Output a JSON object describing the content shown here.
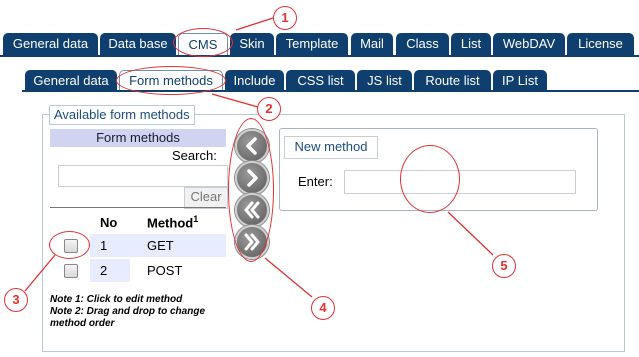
{
  "top_tabs": [
    {
      "label": "General data"
    },
    {
      "label": "Data base"
    },
    {
      "label": "CMS"
    },
    {
      "label": "Skin"
    },
    {
      "label": "Template"
    },
    {
      "label": "Mail"
    },
    {
      "label": "Class"
    },
    {
      "label": "List"
    },
    {
      "label": "WebDAV"
    },
    {
      "label": "License"
    }
  ],
  "sub_tabs": [
    {
      "label": "General data"
    },
    {
      "label": "Form methods"
    },
    {
      "label": "Include"
    },
    {
      "label": "CSS list"
    },
    {
      "label": "JS list"
    },
    {
      "label": "Route list"
    },
    {
      "label": "IP List"
    }
  ],
  "panel": {
    "legend": "Available form methods",
    "header": "Form methods",
    "search_label": "Search:",
    "search_value": "",
    "clear_label": "Clear",
    "col_no": "No",
    "col_method": "Method",
    "col_method_sup": "1",
    "rows": [
      {
        "no": "1",
        "method": "GET"
      },
      {
        "no": "2",
        "method": "POST"
      }
    ],
    "note1": "Note 1: Click to edit method",
    "note2": "Note 2: Drag and drop to change method order"
  },
  "nav_buttons": [
    {
      "icon": "chevron-left-icon"
    },
    {
      "icon": "chevron-right-icon"
    },
    {
      "icon": "double-chevron-left-icon"
    },
    {
      "icon": "double-chevron-right-icon"
    }
  ],
  "editor": {
    "new_method_label": "New method",
    "enter_label": "Enter:",
    "enter_value": ""
  },
  "callouts": [
    "1",
    "2",
    "3",
    "4",
    "5"
  ],
  "colors": {
    "tab": "#0f3f6f",
    "header": "#d0d4f0",
    "callout": "#e23232"
  }
}
